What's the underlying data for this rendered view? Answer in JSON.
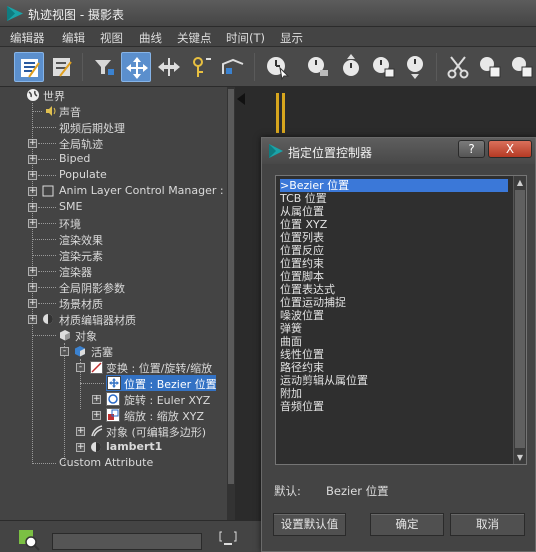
{
  "window": {
    "title": "轨迹视图 - 摄影表"
  },
  "menu": [
    "编辑器",
    "编辑",
    "视图",
    "曲线",
    "关键点",
    "时间(T)",
    "显示"
  ],
  "toolbar_icons": [
    "filter-icon",
    "move-keys-icon",
    "slide-keys-icon",
    "add-keys-icon",
    "scale-keys-icon",
    "time-select-icon",
    "time-scale-icon",
    "time-insert-icon",
    "time-copy-icon",
    "time-paste-icon",
    "time-reverse-icon",
    "cut-icon",
    "copy-icon",
    "paste-icon"
  ],
  "tree": [
    {
      "label": "世界",
      "icon": "globe-icon"
    },
    {
      "label": "声音",
      "icon": "speaker-icon"
    },
    {
      "label": "视频后期处理"
    },
    {
      "label": "全局轨迹"
    },
    {
      "label": "Biped"
    },
    {
      "label": "Populate"
    },
    {
      "label": "Anim Layer Control Manager : MAS"
    },
    {
      "label": "SME"
    },
    {
      "label": "环境"
    },
    {
      "label": "渲染效果"
    },
    {
      "label": "渲染元素"
    },
    {
      "label": "渲染器"
    },
    {
      "label": "全局阴影参数"
    },
    {
      "label": "场景材质"
    },
    {
      "label": "材质编辑器材质"
    },
    {
      "label": "对象"
    },
    {
      "label": "活塞"
    },
    {
      "label": "变换 : 位置/旋转/缩放"
    },
    {
      "label": "位置 : Bezier 位置"
    },
    {
      "label": "旋转 : Euler XYZ"
    },
    {
      "label": "缩放 : 缩放 XYZ"
    },
    {
      "label": "对象 (可编辑多边形)"
    },
    {
      "label": "lambert1"
    },
    {
      "label": "Custom Attribute"
    }
  ],
  "dialog": {
    "title": "指定位置控制器",
    "help_label": "?",
    "close_label": "X",
    "items": [
      ">Bezier 位置",
      "TCB 位置",
      "从属位置",
      "位置 XYZ",
      "位置列表",
      "位置反应",
      "位置约束",
      "位置脚本",
      "位置表达式",
      "位置运动捕捉",
      "噪波位置",
      "弹簧",
      "曲面",
      "线性位置",
      "路径约束",
      "运动剪辑从属位置",
      "附加",
      "音频位置"
    ],
    "selected_index": 0,
    "default_label": "默认:",
    "default_value": "Bezier 位置",
    "set_default_label": "设置默认值",
    "ok_label": "确定",
    "cancel_label": "取消"
  }
}
